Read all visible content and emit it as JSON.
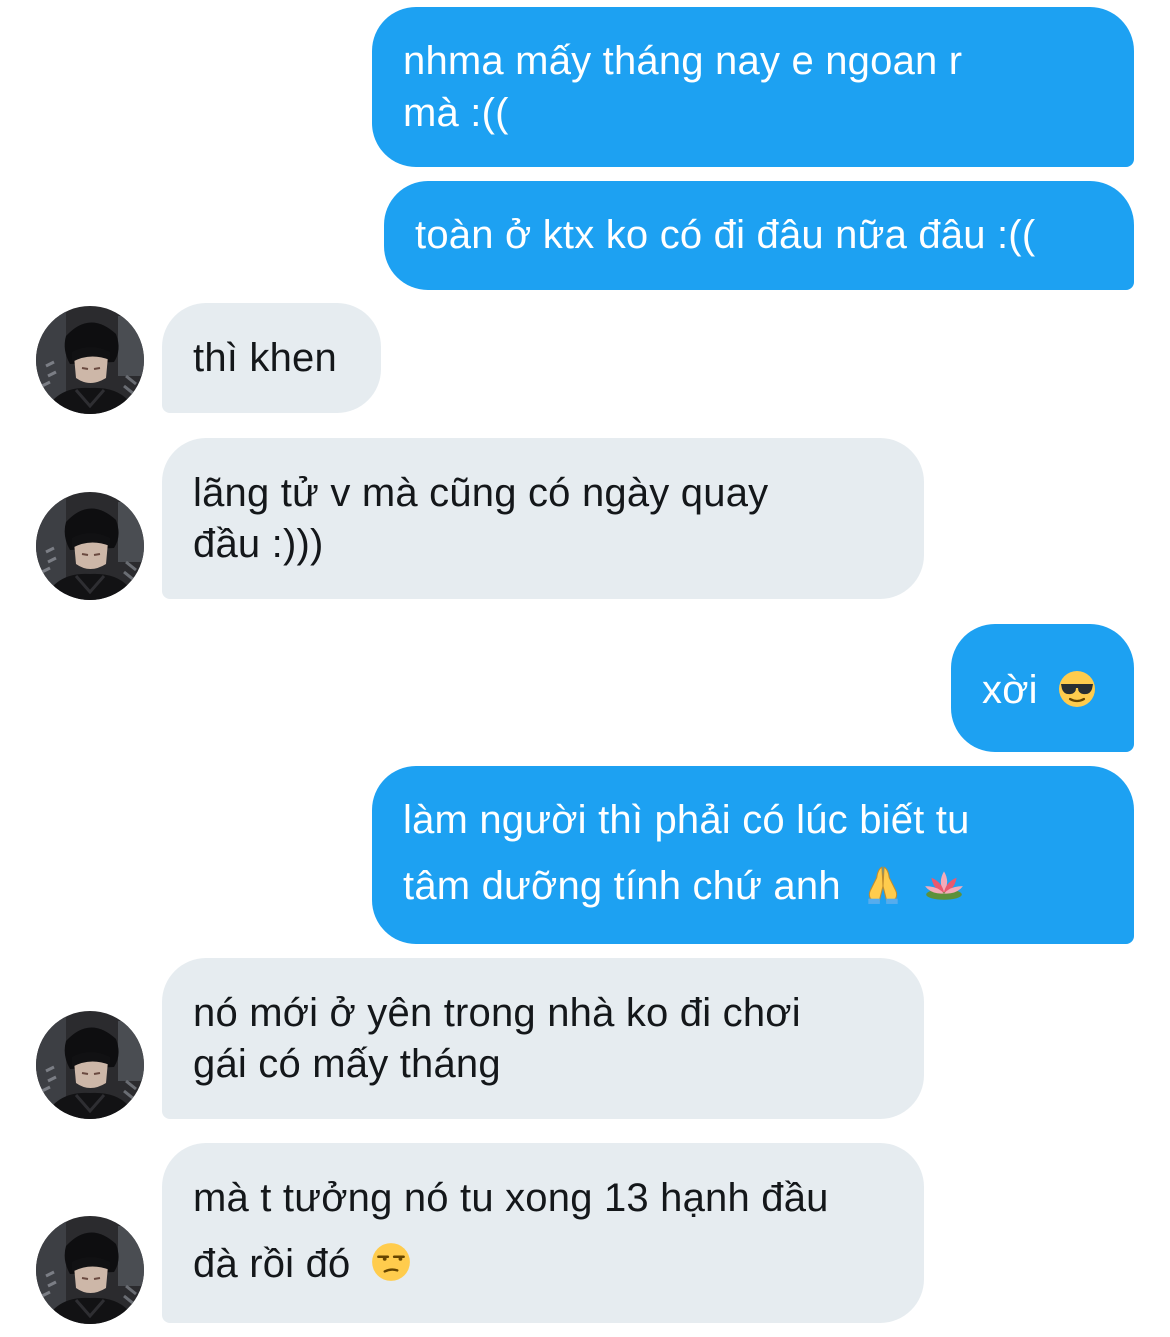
{
  "conversation": {
    "messages": [
      {
        "sender": "me",
        "lines": [
          "nhma mấy tháng nay e ngoan r",
          "mà :(("
        ]
      },
      {
        "sender": "me",
        "lines": [
          "toàn ở ktx ko có đi đâu nữa đâu :(("
        ]
      },
      {
        "sender": "other",
        "lines": [
          "thì khen"
        ]
      },
      {
        "sender": "other",
        "lines": [
          "lãng tử v mà cũng có ngày quay",
          "đầu :)))"
        ]
      },
      {
        "sender": "me",
        "lines": [
          "xời"
        ],
        "emoji": [
          "smiling-face-with-sunglasses"
        ]
      },
      {
        "sender": "me",
        "lines": [
          "làm người thì phải có lúc biết tu",
          "tâm dưỡng tính chứ anh"
        ],
        "emoji": [
          "folded-hands",
          "lotus"
        ]
      },
      {
        "sender": "other",
        "lines": [
          "nó mới ở yên trong nhà ko đi chơi",
          "gái có mấy tháng"
        ]
      },
      {
        "sender": "other",
        "lines": [
          "mà t tưởng nó tu xong 13 hạnh đầu",
          "đà rồi đó"
        ],
        "emoji": [
          "unamused-face"
        ]
      }
    ]
  },
  "colors": {
    "sent_bubble": "#1da1f2",
    "sent_text": "#ffffff",
    "received_bubble": "#e6ecf0",
    "received_text": "#14171a",
    "background": "#ffffff"
  }
}
